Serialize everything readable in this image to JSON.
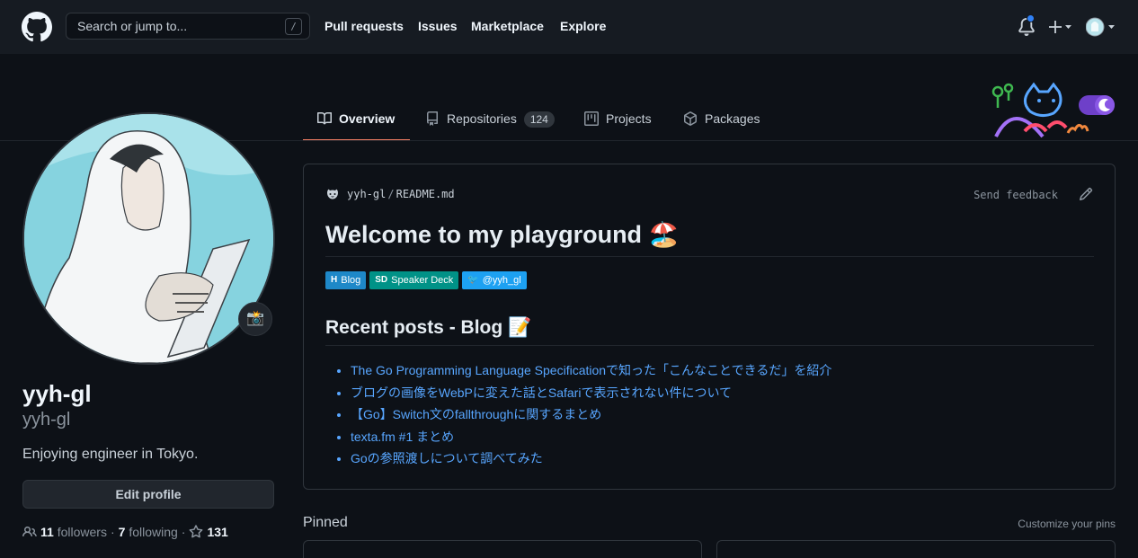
{
  "header": {
    "search_placeholder": "Search or jump to...",
    "search_shortcut": "/",
    "nav": [
      "Pull requests",
      "Issues",
      "Marketplace",
      "Explore"
    ]
  },
  "tabs": [
    {
      "label": "Overview",
      "active": true,
      "icon": "book-icon"
    },
    {
      "label": "Repositories",
      "count": "124",
      "icon": "repo-icon"
    },
    {
      "label": "Projects",
      "icon": "project-icon"
    },
    {
      "label": "Packages",
      "icon": "package-icon"
    }
  ],
  "profile": {
    "fullname": "yyh-gl",
    "username": "yyh-gl",
    "bio": "Enjoying engineer in Tokyo.",
    "edit_button": "Edit profile",
    "followers_count": "11",
    "followers_label": "followers",
    "following_count": "7",
    "following_label": "following",
    "stars": "131",
    "dot": "·",
    "status_emoji": "📸"
  },
  "readme": {
    "owner": "yyh-gl",
    "file": "README.md",
    "feedback": "Send feedback",
    "title": "Welcome to my playground",
    "title_emoji": "🏖️",
    "badges": [
      {
        "icon": "H",
        "label": "Blog",
        "color": "#1e88c8"
      },
      {
        "icon": "SD",
        "label": "Speaker Deck",
        "color": "#009287"
      },
      {
        "icon": "🐦",
        "label": "@yyh_gl",
        "color": "#1da1f2"
      }
    ],
    "recent_title": "Recent posts - Blog",
    "recent_emoji": "📝",
    "posts": [
      "The Go Programming Language Specificationで知った「こんなことできるだ」を紹介",
      "ブログの画像をWebPに変えた話とSafariで表示されない件について",
      "【Go】Switch文のfallthroughに関するまとめ",
      "texta.fm #1 まとめ",
      "Goの参照渡しについて調べてみた"
    ]
  },
  "pinned": {
    "title": "Pinned",
    "customize": "Customize your pins"
  },
  "colors": {
    "background": "#0d1117",
    "header": "#161b22",
    "link": "#58a6ff",
    "tab_underline": "#f78166"
  }
}
